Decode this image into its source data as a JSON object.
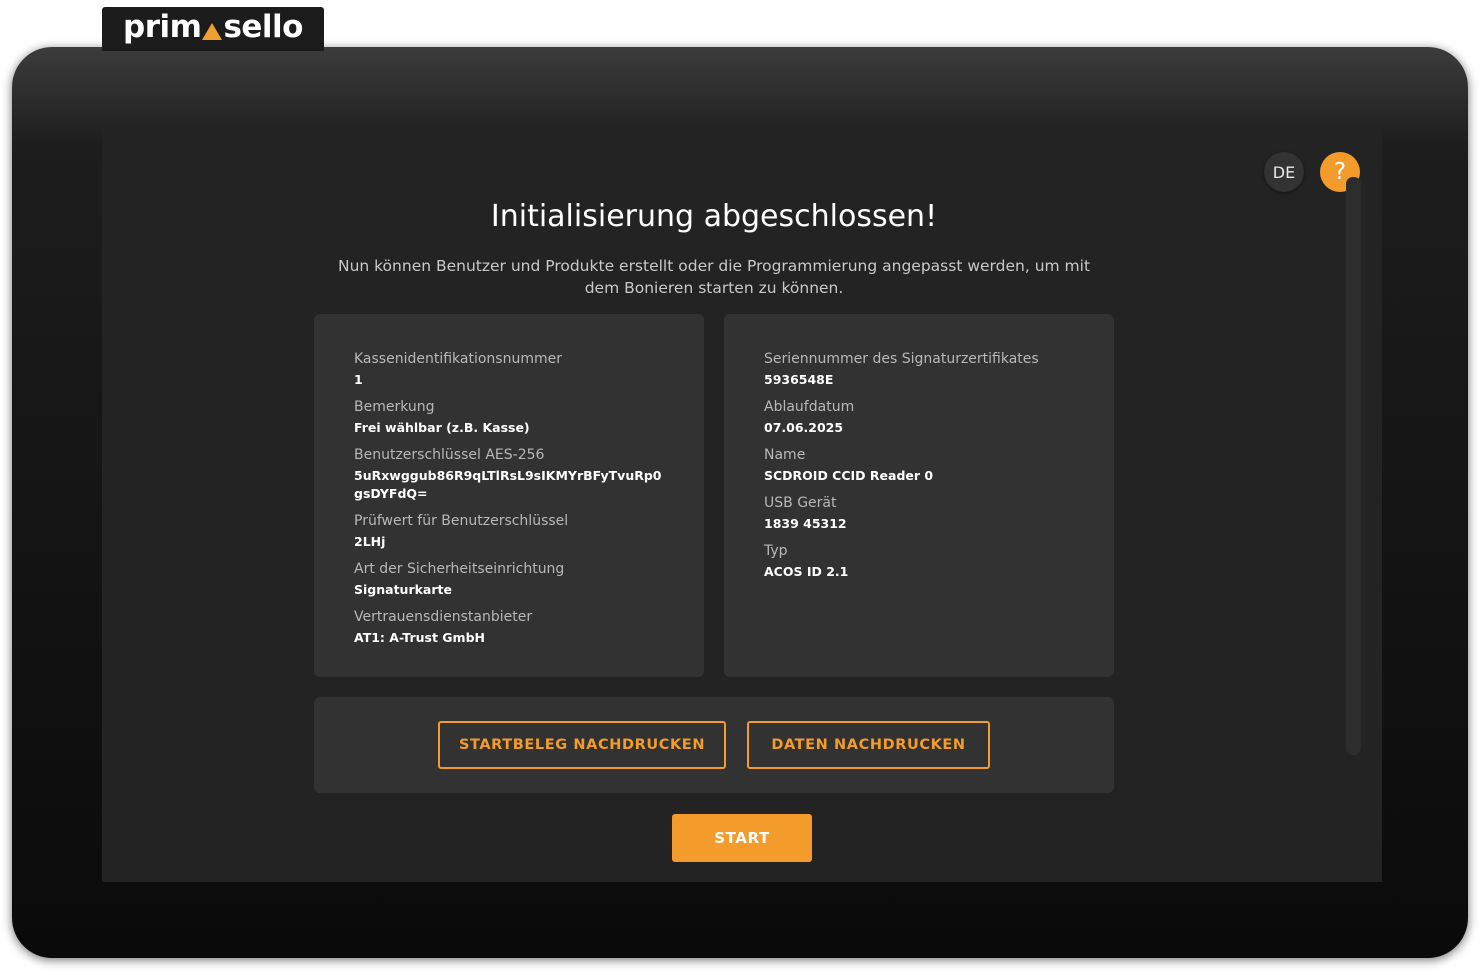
{
  "brand": {
    "logo_left": "prim",
    "logo_right": "sello",
    "accent_color": "#f39c2c"
  },
  "header": {
    "language": "DE",
    "help_symbol": "?"
  },
  "main": {
    "title": "Initialisierung abgeschlossen!",
    "subtitle": "Nun können Benutzer und Produkte erstellt oder die Programmierung angepasst werden, um mit dem Bonieren starten zu können."
  },
  "left_card": {
    "fields": [
      {
        "label": "Kassenidentifikationsnummer",
        "value": "1"
      },
      {
        "label": "Bemerkung",
        "value": "Frei wählbar (z.B. Kasse)"
      },
      {
        "label": "Benutzerschlüssel AES-256",
        "value": "5uRxwggub86R9qLTlRsL9sIKMYrBFyTvuRp0gsDYFdQ="
      },
      {
        "label": "Prüfwert für Benutzerschlüssel",
        "value": "2LHj"
      },
      {
        "label": "Art der Sicherheitseinrichtung",
        "value": "Signaturkarte"
      },
      {
        "label": "Vertrauensdienstanbieter",
        "value": "AT1: A-Trust GmbH"
      }
    ]
  },
  "right_card": {
    "fields": [
      {
        "label": "Seriennummer des Signaturzertifikates",
        "value": "5936548E"
      },
      {
        "label": "Ablaufdatum",
        "value": "07.06.2025"
      },
      {
        "label": "Name",
        "value": "SCDROID CCID Reader 0"
      },
      {
        "label": "USB Gerät",
        "value": "1839 45312"
      },
      {
        "label": "Typ",
        "value": "ACOS ID 2.1"
      }
    ]
  },
  "actions": {
    "reprint_start_receipt": "STARTBELEG NACHDRUCKEN",
    "reprint_data": "DATEN NACHDRUCKEN",
    "start": "START"
  }
}
